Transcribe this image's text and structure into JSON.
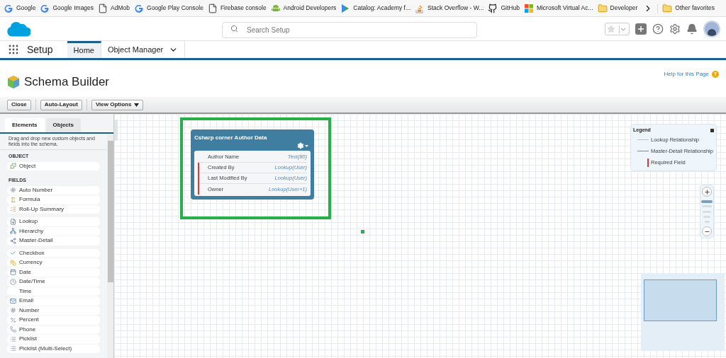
{
  "bookmarks": [
    {
      "label": "Google"
    },
    {
      "label": "Google Images"
    },
    {
      "label": "AdMob"
    },
    {
      "label": "Google Play Console"
    },
    {
      "label": "Firebase console"
    },
    {
      "label": "Android Developers"
    },
    {
      "label": "Catalog: Academy f..."
    },
    {
      "label": "Stack Overflow - W..."
    },
    {
      "label": "GitHub"
    },
    {
      "label": "Microsoft Virtual Ac..."
    },
    {
      "label": "Developer"
    }
  ],
  "other_bookmarks": "Other favorites",
  "search": {
    "placeholder": "Search Setup"
  },
  "app_name": "Setup",
  "nav_tabs": [
    {
      "label": "Home",
      "selected": true
    },
    {
      "label": "Object Manager",
      "selected": false
    }
  ],
  "page_title": "Schema Builder",
  "help_link": "Help for this Page",
  "help_badge": "?",
  "toolbar": [
    "Close",
    "Auto-Layout",
    "View Options"
  ],
  "palette": {
    "tabs": [
      {
        "label": "Elements",
        "selected": true
      },
      {
        "label": "Objects",
        "selected": false
      }
    ],
    "hint": "Drag and drop new custom objects and fields into the schema.",
    "sections": [
      {
        "heading": "OBJECT",
        "groups": [
          [
            "Object"
          ]
        ]
      },
      {
        "heading": "FIELDS",
        "groups": [
          [
            "Auto Number",
            "Formula",
            "Roll-Up Summary"
          ],
          [
            "Lookup",
            "Hierarchy",
            "Master-Detail"
          ],
          [
            "Checkbox",
            "Currency",
            "Date",
            "Date/Time",
            "Time",
            "Email",
            "Number",
            "Percent",
            "Phone",
            "Picklist",
            "Picklist (Multi-Select)"
          ]
        ]
      }
    ]
  },
  "object_card": {
    "title": "Csharp corner Author Data",
    "selected": true,
    "fields": [
      {
        "name": "Author Name",
        "type": "Text(80)",
        "required": false
      },
      {
        "name": "Created By",
        "type": "Lookup(User)",
        "required": true
      },
      {
        "name": "Last Modified By",
        "type": "Lookup(User)",
        "required": true
      },
      {
        "name": "Owner",
        "type": "Lookup(User+1)",
        "required": true
      }
    ]
  },
  "legend": {
    "title": "Legend",
    "items": [
      {
        "label": "Lookup Relationship",
        "kind": "lookup"
      },
      {
        "label": "Master-Detail Relationship",
        "kind": "master"
      },
      {
        "label": "Required Field",
        "kind": "required"
      }
    ]
  },
  "zoom": {
    "level": 1
  }
}
